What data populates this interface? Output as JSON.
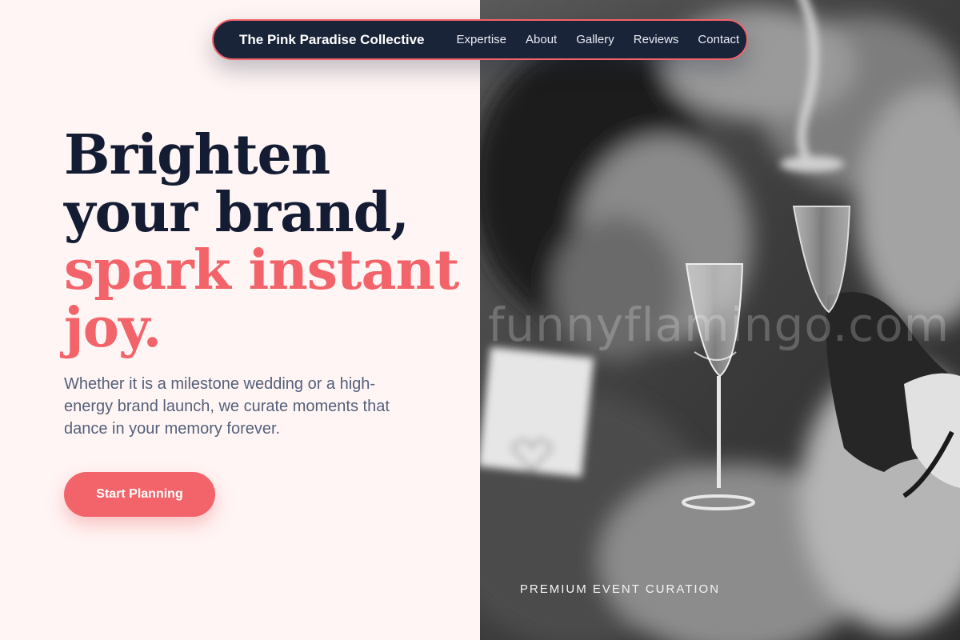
{
  "nav": {
    "brand": "The Pink Paradise Collective",
    "links": [
      "Expertise",
      "About",
      "Gallery",
      "Reviews",
      "Contact"
    ]
  },
  "hero": {
    "headline_line1": "Brighten",
    "headline_line2": "your brand,",
    "headline_accent_line1": "spark instant",
    "headline_accent_line2": "joy.",
    "subtext": "Whether it is a milestone wedding or a high-energy brand launch, we curate moments that dance in your memory forever.",
    "cta_label": "Start Planning"
  },
  "image": {
    "watermark": "funnyflamingo.com",
    "caption": "PREMIUM EVENT CURATION",
    "icons": [
      "champagne-glass-icon",
      "hand-icon"
    ]
  },
  "colors": {
    "navy": "#1a2439",
    "coral": "#f2646a",
    "background": "#fff5f4"
  }
}
